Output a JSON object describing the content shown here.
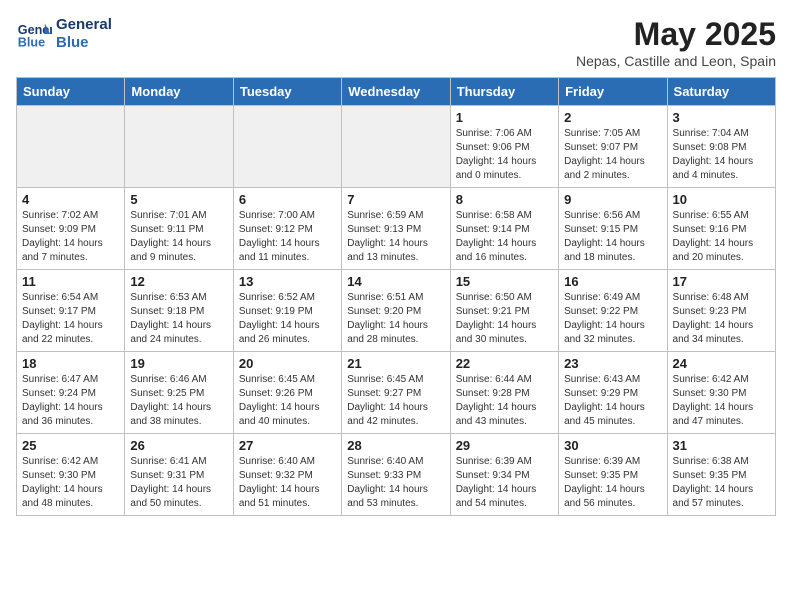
{
  "header": {
    "logo_line1": "General",
    "logo_line2": "Blue",
    "month_title": "May 2025",
    "location": "Nepas, Castille and Leon, Spain"
  },
  "weekdays": [
    "Sunday",
    "Monday",
    "Tuesday",
    "Wednesday",
    "Thursday",
    "Friday",
    "Saturday"
  ],
  "weeks": [
    [
      {
        "day": "",
        "info": ""
      },
      {
        "day": "",
        "info": ""
      },
      {
        "day": "",
        "info": ""
      },
      {
        "day": "",
        "info": ""
      },
      {
        "day": "1",
        "info": "Sunrise: 7:06 AM\nSunset: 9:06 PM\nDaylight: 14 hours and 0 minutes."
      },
      {
        "day": "2",
        "info": "Sunrise: 7:05 AM\nSunset: 9:07 PM\nDaylight: 14 hours and 2 minutes."
      },
      {
        "day": "3",
        "info": "Sunrise: 7:04 AM\nSunset: 9:08 PM\nDaylight: 14 hours and 4 minutes."
      }
    ],
    [
      {
        "day": "4",
        "info": "Sunrise: 7:02 AM\nSunset: 9:09 PM\nDaylight: 14 hours and 7 minutes."
      },
      {
        "day": "5",
        "info": "Sunrise: 7:01 AM\nSunset: 9:11 PM\nDaylight: 14 hours and 9 minutes."
      },
      {
        "day": "6",
        "info": "Sunrise: 7:00 AM\nSunset: 9:12 PM\nDaylight: 14 hours and 11 minutes."
      },
      {
        "day": "7",
        "info": "Sunrise: 6:59 AM\nSunset: 9:13 PM\nDaylight: 14 hours and 13 minutes."
      },
      {
        "day": "8",
        "info": "Sunrise: 6:58 AM\nSunset: 9:14 PM\nDaylight: 14 hours and 16 minutes."
      },
      {
        "day": "9",
        "info": "Sunrise: 6:56 AM\nSunset: 9:15 PM\nDaylight: 14 hours and 18 minutes."
      },
      {
        "day": "10",
        "info": "Sunrise: 6:55 AM\nSunset: 9:16 PM\nDaylight: 14 hours and 20 minutes."
      }
    ],
    [
      {
        "day": "11",
        "info": "Sunrise: 6:54 AM\nSunset: 9:17 PM\nDaylight: 14 hours and 22 minutes."
      },
      {
        "day": "12",
        "info": "Sunrise: 6:53 AM\nSunset: 9:18 PM\nDaylight: 14 hours and 24 minutes."
      },
      {
        "day": "13",
        "info": "Sunrise: 6:52 AM\nSunset: 9:19 PM\nDaylight: 14 hours and 26 minutes."
      },
      {
        "day": "14",
        "info": "Sunrise: 6:51 AM\nSunset: 9:20 PM\nDaylight: 14 hours and 28 minutes."
      },
      {
        "day": "15",
        "info": "Sunrise: 6:50 AM\nSunset: 9:21 PM\nDaylight: 14 hours and 30 minutes."
      },
      {
        "day": "16",
        "info": "Sunrise: 6:49 AM\nSunset: 9:22 PM\nDaylight: 14 hours and 32 minutes."
      },
      {
        "day": "17",
        "info": "Sunrise: 6:48 AM\nSunset: 9:23 PM\nDaylight: 14 hours and 34 minutes."
      }
    ],
    [
      {
        "day": "18",
        "info": "Sunrise: 6:47 AM\nSunset: 9:24 PM\nDaylight: 14 hours and 36 minutes."
      },
      {
        "day": "19",
        "info": "Sunrise: 6:46 AM\nSunset: 9:25 PM\nDaylight: 14 hours and 38 minutes."
      },
      {
        "day": "20",
        "info": "Sunrise: 6:45 AM\nSunset: 9:26 PM\nDaylight: 14 hours and 40 minutes."
      },
      {
        "day": "21",
        "info": "Sunrise: 6:45 AM\nSunset: 9:27 PM\nDaylight: 14 hours and 42 minutes."
      },
      {
        "day": "22",
        "info": "Sunrise: 6:44 AM\nSunset: 9:28 PM\nDaylight: 14 hours and 43 minutes."
      },
      {
        "day": "23",
        "info": "Sunrise: 6:43 AM\nSunset: 9:29 PM\nDaylight: 14 hours and 45 minutes."
      },
      {
        "day": "24",
        "info": "Sunrise: 6:42 AM\nSunset: 9:30 PM\nDaylight: 14 hours and 47 minutes."
      }
    ],
    [
      {
        "day": "25",
        "info": "Sunrise: 6:42 AM\nSunset: 9:30 PM\nDaylight: 14 hours and 48 minutes."
      },
      {
        "day": "26",
        "info": "Sunrise: 6:41 AM\nSunset: 9:31 PM\nDaylight: 14 hours and 50 minutes."
      },
      {
        "day": "27",
        "info": "Sunrise: 6:40 AM\nSunset: 9:32 PM\nDaylight: 14 hours and 51 minutes."
      },
      {
        "day": "28",
        "info": "Sunrise: 6:40 AM\nSunset: 9:33 PM\nDaylight: 14 hours and 53 minutes."
      },
      {
        "day": "29",
        "info": "Sunrise: 6:39 AM\nSunset: 9:34 PM\nDaylight: 14 hours and 54 minutes."
      },
      {
        "day": "30",
        "info": "Sunrise: 6:39 AM\nSunset: 9:35 PM\nDaylight: 14 hours and 56 minutes."
      },
      {
        "day": "31",
        "info": "Sunrise: 6:38 AM\nSunset: 9:35 PM\nDaylight: 14 hours and 57 minutes."
      }
    ]
  ]
}
